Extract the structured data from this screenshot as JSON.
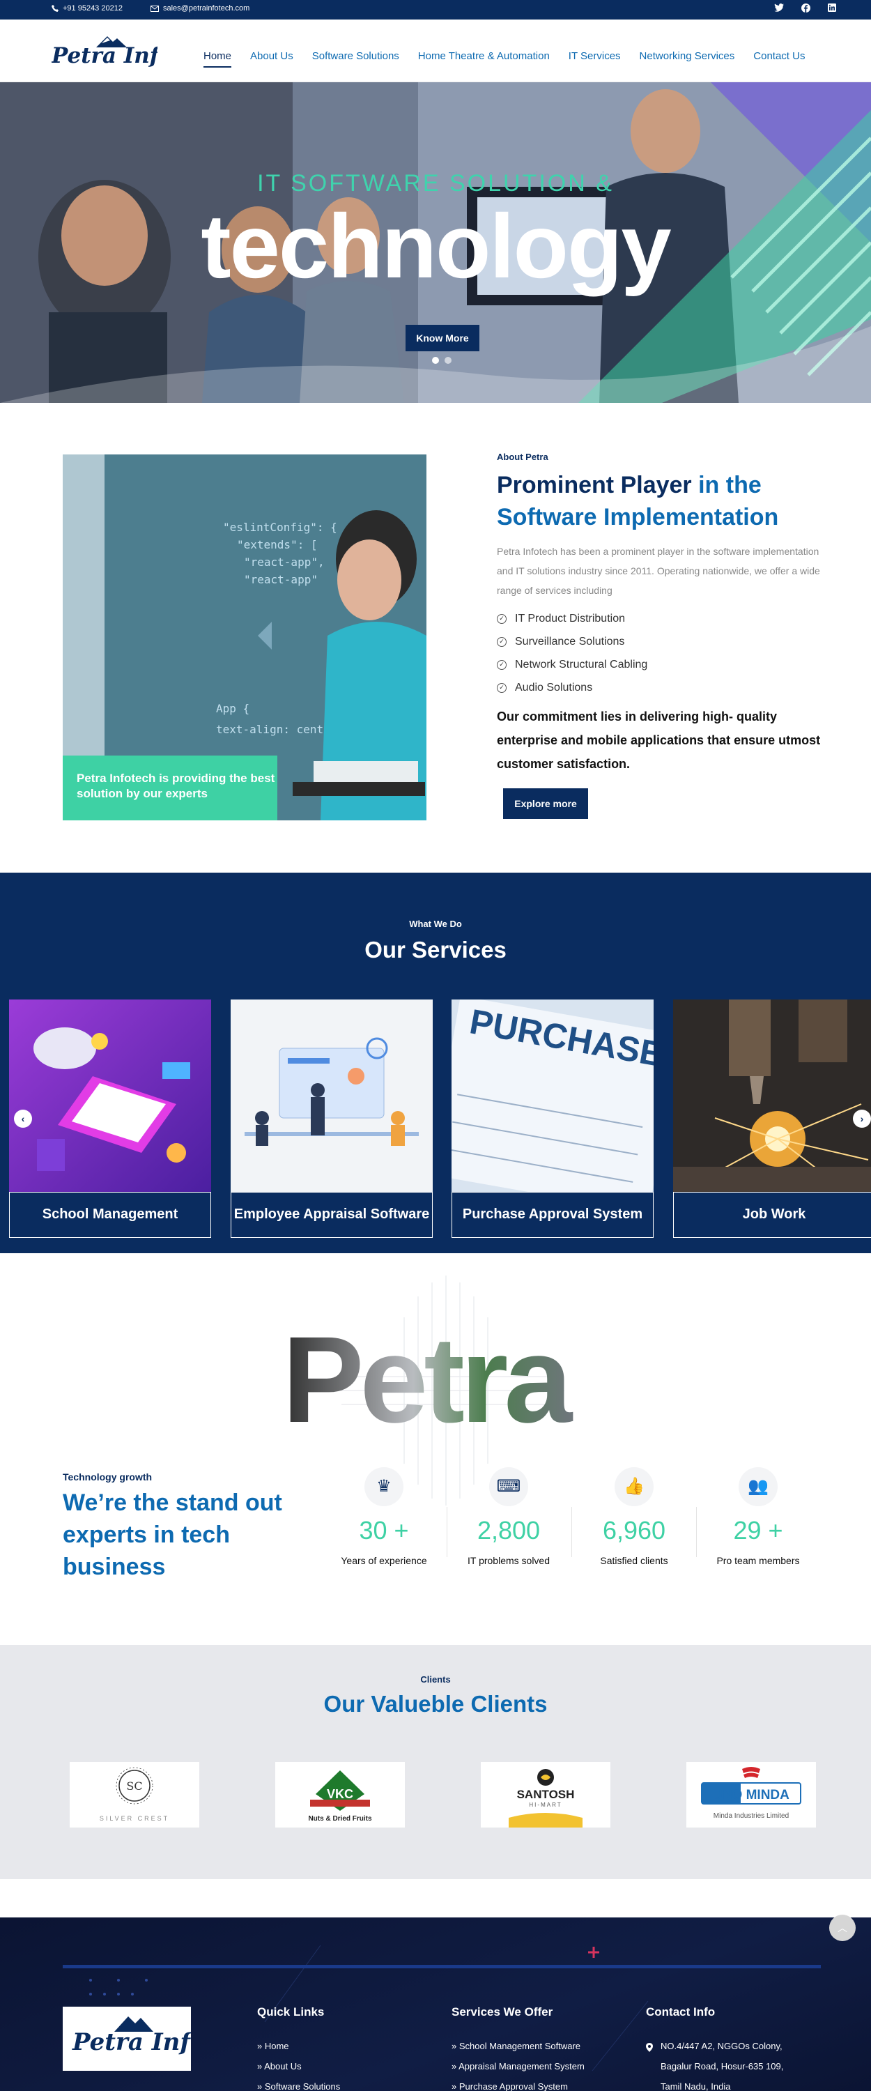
{
  "topbar": {
    "phone": "+91 95243 20212",
    "email": "sales@petrainfotech.com",
    "social": [
      "twitter-icon",
      "facebook-icon",
      "linkedin-icon"
    ]
  },
  "brand": {
    "logo_text": "Petra Infotech"
  },
  "nav": {
    "items": [
      "Home",
      "About Us",
      "Software Solutions",
      "Home Theatre & Automation",
      "IT Services",
      "Networking Services",
      "Contact Us"
    ],
    "active": "Home"
  },
  "hero": {
    "subtitle": "IT SOFTWARE SOLUTION &",
    "title": "technology",
    "button": "Know More",
    "slides": 2,
    "active_slide": 1
  },
  "about": {
    "kicker": "About Petra",
    "heading_dark": "Prominent Player",
    "heading_accent": "in the Software Implementation",
    "paragraph": "Petra Infotech has been a prominent player in the software implementation and IT solutions industry since 2011. Operating nationwide, we offer a wide range of services including",
    "list": [
      "IT Product Distribution",
      "Surveillance Solutions",
      "Network Structural Cabling",
      "Audio Solutions"
    ],
    "commitment": "Our commitment lies in delivering high- quality enterprise and mobile applications that ensure utmost customer satisfaction.",
    "badge": "Petra Infotech is providing the best solution by our experts",
    "button": "Explore more"
  },
  "services": {
    "kicker": "What We Do",
    "title": "Our Services",
    "cards": [
      "School Management",
      "Employee Appraisal Software",
      "Purchase Approval System",
      "Job Work"
    ],
    "purchase_order_text": "PURCHASE ORDER"
  },
  "growth": {
    "watermark": "Petra",
    "kicker": "Technology growth",
    "heading": "We’re the stand out experts in tech business",
    "stats": [
      {
        "icon": "crown-icon",
        "number": "30 +",
        "label": "Years of experience"
      },
      {
        "icon": "code-laptop-icon",
        "number": "2,800",
        "label": "IT problems solved"
      },
      {
        "icon": "thumbs-up-icon",
        "number": "6,960",
        "label": "Satisfied clients"
      },
      {
        "icon": "team-icon",
        "number": "29 +",
        "label": "Pro team members"
      }
    ]
  },
  "clients": {
    "kicker": "Clients",
    "title": "Our Valueble Clients",
    "logos": [
      {
        "main": "SC",
        "sub": "SILVER CREST"
      },
      {
        "main": "VKC",
        "sub": "Nuts & Dried Fruits"
      },
      {
        "main": "SANTOSH",
        "sub": "HI-MART"
      },
      {
        "main": "UNO MINDA",
        "sub": "Minda Industries Limited"
      }
    ]
  },
  "footer": {
    "quick_links_title": "Quick Links",
    "quick_links": [
      "Home",
      "About Us",
      "Software Solutions"
    ],
    "services_title": "Services We Offer",
    "services": [
      "School Management Software",
      "Appraisal Management System",
      "Purchase Approval System"
    ],
    "contact_title": "Contact Info",
    "address_lines": [
      "NO.4/447 A2, NGGOs Colony,",
      "Bagalur Road, Hosur-635 109,",
      "Tamil Nadu, India"
    ]
  },
  "colors": {
    "navy": "#0a2c5f",
    "blue": "#0d6ab1",
    "green": "#3ed1a4",
    "footer": "#0b1433"
  }
}
